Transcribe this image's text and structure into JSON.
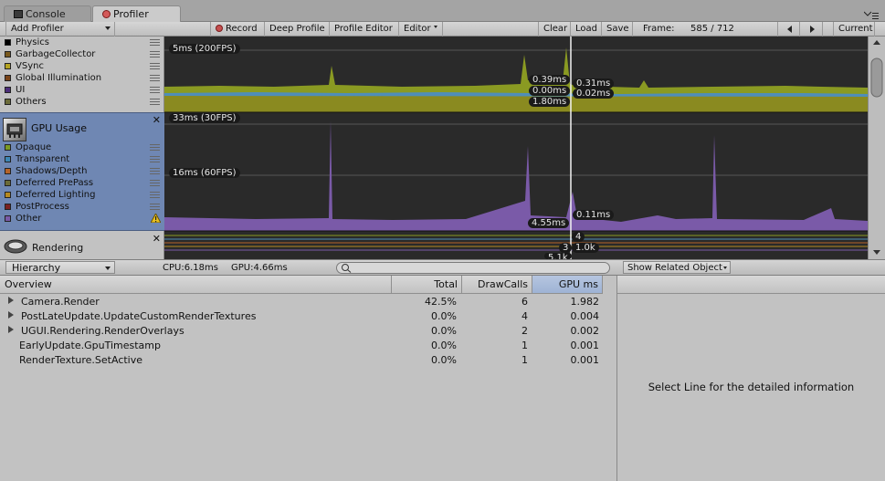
{
  "tabs": [
    {
      "label": "Console",
      "icon": "console-icon"
    },
    {
      "label": "Profiler",
      "icon": "profiler-icon",
      "active": true
    }
  ],
  "toolbar": {
    "add_profiler": "Add Profiler",
    "record": "Record",
    "deep_profile": "Deep Profile",
    "profile_editor": "Profile Editor",
    "editor": "Editor",
    "clear": "Clear",
    "load": "Load",
    "save": "Save",
    "frame_label": "Frame:",
    "frame_value": "585 / 712",
    "current": "Current"
  },
  "cpu_section": {
    "items": [
      {
        "label": "Physics",
        "color": "#000000"
      },
      {
        "label": "GarbageCollector",
        "color": "#7a5a1e"
      },
      {
        "label": "VSync",
        "color": "#b5a421"
      },
      {
        "label": "Global Illumination",
        "color": "#7a4419"
      },
      {
        "label": "UI",
        "color": "#4c2e7a"
      },
      {
        "label": "Others",
        "color": "#6c6c3a"
      }
    ],
    "chart": {
      "scale_label": "5ms (200FPS)",
      "markers": [
        "0.39ms",
        "0.00ms",
        "1.80ms",
        "0.31ms",
        "0.02ms"
      ]
    }
  },
  "gpu_section": {
    "title": "GPU Usage",
    "items": [
      {
        "label": "Opaque",
        "color": "#7a9a23"
      },
      {
        "label": "Transparent",
        "color": "#3d86b5"
      },
      {
        "label": "Shadows/Depth",
        "color": "#b5642a"
      },
      {
        "label": "Deferred PrePass",
        "color": "#6b6b39"
      },
      {
        "label": "Deferred Lighting",
        "color": "#b58a21"
      },
      {
        "label": "PostProcess",
        "color": "#7a2121"
      },
      {
        "label": "Other",
        "color": "#7a5aa8"
      }
    ],
    "chart": {
      "scale_top": "33ms (30FPS)",
      "scale_mid": "16ms (60FPS)",
      "markers": [
        "4.55ms",
        "0.11ms"
      ]
    }
  },
  "rendering_section": {
    "title": "Rendering",
    "markers": [
      "4",
      "3",
      "1.0k",
      "5.1k"
    ]
  },
  "status": {
    "view_mode": "Hierarchy",
    "cpu": "CPU:6.18ms",
    "gpu": "GPU:4.66ms",
    "search_placeholder": "",
    "related": "Show Related Object"
  },
  "table": {
    "headers": [
      "Overview",
      "Total",
      "DrawCalls",
      "GPU ms"
    ],
    "rows": [
      {
        "name": "Camera.Render",
        "expandable": true,
        "total": "42.5%",
        "drawcalls": "6",
        "gpu": "1.982"
      },
      {
        "name": "PostLateUpdate.UpdateCustomRenderTextures",
        "expandable": true,
        "total": "0.0%",
        "drawcalls": "4",
        "gpu": "0.004"
      },
      {
        "name": "UGUI.Rendering.RenderOverlays",
        "expandable": true,
        "total": "0.0%",
        "drawcalls": "2",
        "gpu": "0.002"
      },
      {
        "name": "EarlyUpdate.GpuTimestamp",
        "expandable": false,
        "total": "0.0%",
        "drawcalls": "1",
        "gpu": "0.001"
      },
      {
        "name": "RenderTexture.SetActive",
        "expandable": false,
        "total": "0.0%",
        "drawcalls": "1",
        "gpu": "0.001"
      }
    ]
  },
  "detail": {
    "message": "Select Line for the detailed information"
  }
}
